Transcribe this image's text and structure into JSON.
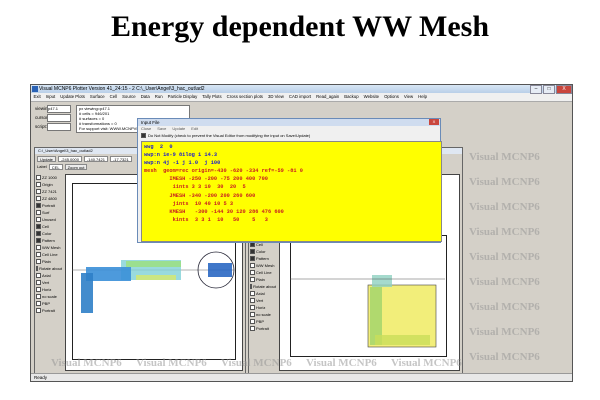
{
  "slide_title": "Energy dependent WW Mesh",
  "app": {
    "title": "Visual MCNP6 Plotter Version 41_24:15 - 2  C:\\_User\\Angel\\3_hac_out\\ad2",
    "window_controls": [
      "–",
      "□",
      "X"
    ],
    "menu": [
      "Exit",
      "Input",
      "Update Plots",
      "Surface",
      "Cell",
      "Source",
      "Data",
      "Run",
      "Particle Display",
      "Tally Plots",
      "Cross section plots",
      "3D View",
      "CAD import",
      "Read_again",
      "Backup",
      "Website",
      "Options",
      "View",
      "Help"
    ],
    "top_panel": {
      "viewing_label": "viewing:",
      "viewing_value": "p47.1",
      "cursor_label": "cursor:",
      "script_label": "script:",
      "info_lines": [
        "px viewing=p47.1",
        "# cells = 946/201",
        "# surfaces = 0",
        "# transformations = 0",
        "For support visit: WWW.MCNPVISED.COM"
      ]
    },
    "left_plot": {
      "title": "C:\\_User\\Angel\\3_hac_out\\ad2",
      "update_button": "Update",
      "label_label": "Label",
      "label_value": "CEL",
      "origin_values": [
        "-245.0000",
        "-140.7421",
        "-17.7321"
      ],
      "zoom_label": "Zoom out",
      "side_items": [
        {
          "label": "ZZ 1000",
          "checked": false
        },
        {
          "label": "Origin",
          "checked": false
        },
        {
          "label": "ZZ 7421",
          "checked": false
        },
        {
          "label": "ZZ 4800",
          "checked": false
        },
        {
          "label": "Portrait",
          "checked": true
        },
        {
          "label": "Surf",
          "checked": false
        },
        {
          "label": "Unused",
          "checked": false
        },
        {
          "label": "Cell",
          "checked": true
        },
        {
          "label": "Color",
          "checked": true
        },
        {
          "label": "Pattern",
          "checked": true
        },
        {
          "label": "WW Mesh",
          "checked": false
        },
        {
          "label": "Cell Line",
          "checked": false
        },
        {
          "label": "Plain",
          "checked": false
        },
        {
          "label": "Rotate about",
          "checked": false
        },
        {
          "label": "Axial",
          "checked": false
        },
        {
          "label": "Vert",
          "checked": false
        },
        {
          "label": "Horiz",
          "checked": false
        },
        {
          "label": "no scale",
          "checked": false
        },
        {
          "label": "PBP",
          "checked": false
        },
        {
          "label": "Portrait",
          "checked": false
        }
      ]
    },
    "right_plot": {
      "update_button": "Update",
      "side_items": [
        {
          "label": "Portrait",
          "checked": true
        },
        {
          "label": "Surf",
          "checked": false
        },
        {
          "label": "Unused",
          "checked": false
        },
        {
          "label": "Cell",
          "checked": true
        },
        {
          "label": "Color",
          "checked": true
        },
        {
          "label": "Pattern",
          "checked": true
        },
        {
          "label": "WW Mesh",
          "checked": false
        },
        {
          "label": "Cell Line",
          "checked": false
        },
        {
          "label": "Plain",
          "checked": false
        },
        {
          "label": "Rotate about",
          "checked": false
        },
        {
          "label": "Axial",
          "checked": false
        },
        {
          "label": "Vert",
          "checked": false
        },
        {
          "label": "Horiz",
          "checked": false
        },
        {
          "label": "no scale",
          "checked": false
        },
        {
          "label": "PBP",
          "checked": false
        },
        {
          "label": "Portrait",
          "checked": false
        }
      ]
    },
    "input_file": {
      "title": "Input File",
      "close_label": "X",
      "menu": [
        "Close",
        "Save",
        "Update",
        "Edit"
      ],
      "checkbox_label": "Do Not Modify (check to prevent the Visual Editor from modifying the input on Save/Update)",
      "lines": [
        {
          "text": "wwg  2  0",
          "color": "blue"
        },
        {
          "text": "wwp:n 1e-9 8ilog 1 14.3",
          "color": "blue"
        },
        {
          "text": "wwp:n 4j -1 j 1.0  j 100",
          "color": "blue"
        },
        {
          "text": "mesh  geom=rec origin=-430 -620 -334 ref=-59 -81 0",
          "color": "red"
        },
        {
          "text": "        IMESH -250 -200 -75 200 400 700",
          "color": "red"
        },
        {
          "text": "         iints 3 3 10  30  20  5",
          "color": "red"
        },
        {
          "text": "        JMESH -340 -200 200 260 600",
          "color": "red"
        },
        {
          "text": "         jints  10 40 10 5 3",
          "color": "red"
        },
        {
          "text": "        KMESH   -300 -144 30 120 286 476 600",
          "color": "red"
        },
        {
          "text": "         kints  3 3 1  10   50    5   3",
          "color": "red"
        }
      ]
    },
    "watermark": "Visual MCNP6",
    "status_text": "Ready"
  },
  "colors": {
    "editor_background": "#ffff00",
    "keyword_blue": "#1a1ad0",
    "mesh_red": "#c82020"
  }
}
